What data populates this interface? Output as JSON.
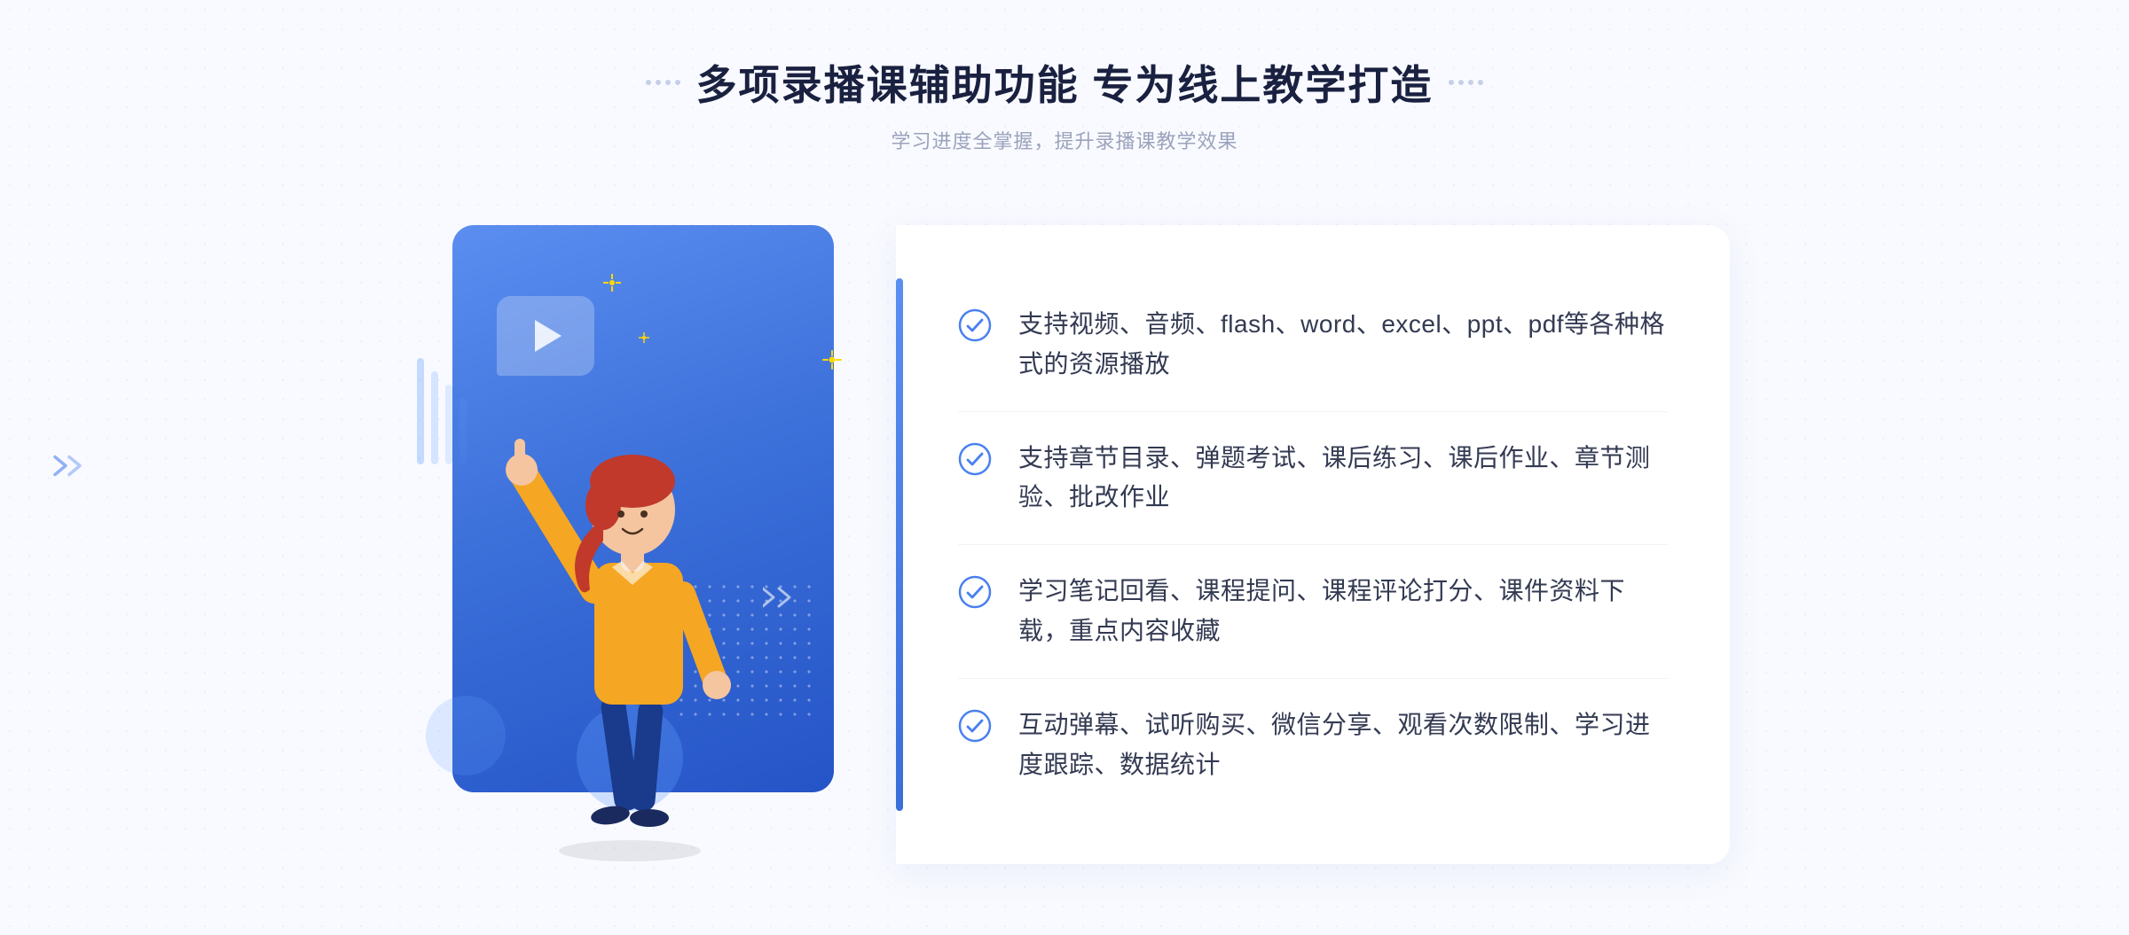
{
  "header": {
    "title": "多项录播课辅助功能 专为线上教学打造",
    "subtitle": "学习进度全掌握，提升录播课教学效果"
  },
  "features": [
    {
      "id": "feature-1",
      "text": "支持视频、音频、flash、word、excel、ppt、pdf等各种格式的资源播放"
    },
    {
      "id": "feature-2",
      "text": "支持章节目录、弹题考试、课后练习、课后作业、章节测验、批改作业"
    },
    {
      "id": "feature-3",
      "text": "学习笔记回看、课程提问、课程评论打分、课件资料下载，重点内容收藏"
    },
    {
      "id": "feature-4",
      "text": "互动弹幕、试听购买、微信分享、观看次数限制、学习进度跟踪、数据统计"
    }
  ],
  "decorative": {
    "dots_left": "❮❮",
    "dots_right": "···"
  }
}
